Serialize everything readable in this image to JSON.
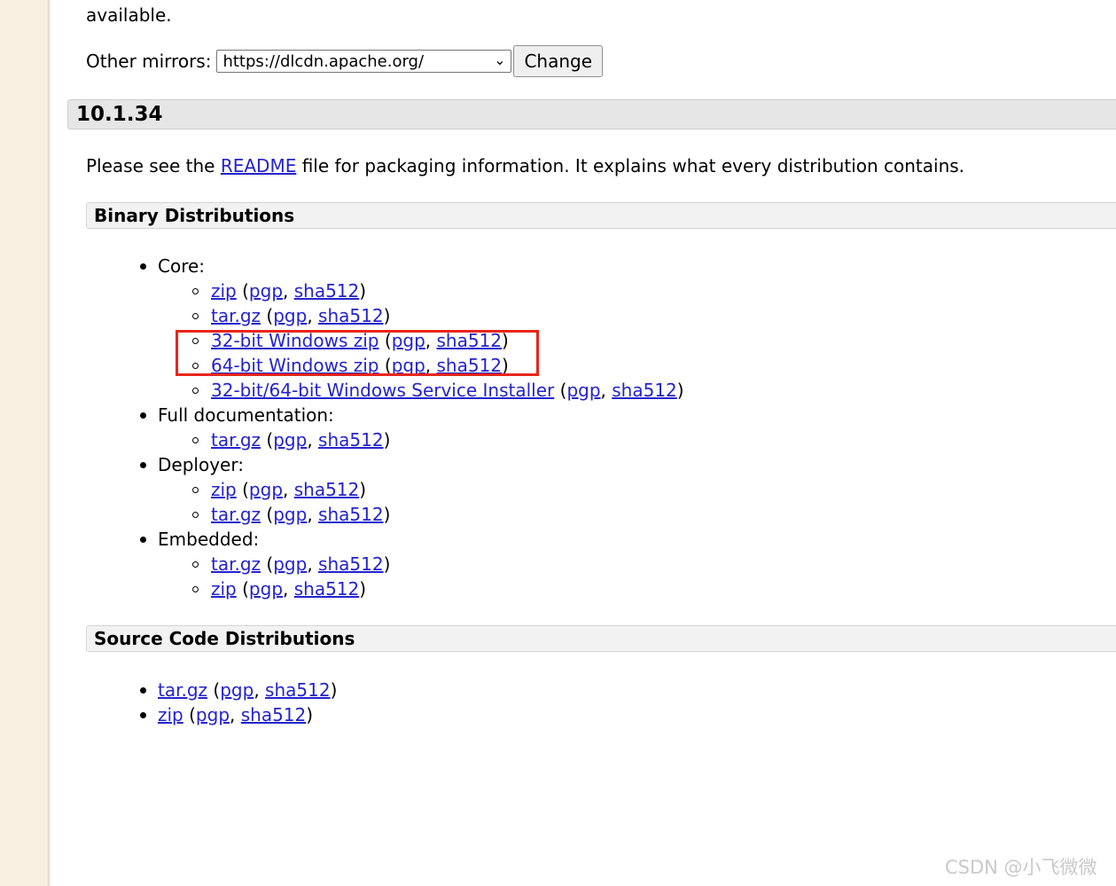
{
  "top_text": "available.",
  "mirrors": {
    "label": "Other mirrors:",
    "selected": "https://dlcdn.apache.org/",
    "button": "Change"
  },
  "version": "10.1.34",
  "readme": {
    "before": "Please see the ",
    "link": "README",
    "after": " file for packaging information. It explains what every distribution contains."
  },
  "binary_title": "Binary Distributions",
  "binary": {
    "core_label": "Core:",
    "core": [
      {
        "name": "zip",
        "pgp": "pgp",
        "sha": "sha512"
      },
      {
        "name": "tar.gz",
        "pgp": "pgp",
        "sha": "sha512"
      },
      {
        "name": "32-bit Windows zip",
        "pgp": "pgp",
        "sha": "sha512"
      },
      {
        "name": "64-bit Windows zip",
        "pgp": "pgp",
        "sha": "sha512"
      },
      {
        "name": "32-bit/64-bit Windows Service Installer",
        "pgp": "pgp",
        "sha": "sha512"
      }
    ],
    "docs_label": "Full documentation:",
    "docs": [
      {
        "name": "tar.gz",
        "pgp": "pgp",
        "sha": "sha512"
      }
    ],
    "deployer_label": "Deployer:",
    "deployer": [
      {
        "name": "zip",
        "pgp": "pgp",
        "sha": "sha512"
      },
      {
        "name": "tar.gz",
        "pgp": "pgp",
        "sha": "sha512"
      }
    ],
    "embedded_label": "Embedded:",
    "embedded": [
      {
        "name": "tar.gz",
        "pgp": "pgp",
        "sha": "sha512"
      },
      {
        "name": "zip",
        "pgp": "pgp",
        "sha": "sha512"
      }
    ]
  },
  "source_title": "Source Code Distributions",
  "source": [
    {
      "name": "tar.gz",
      "pgp": "pgp",
      "sha": "sha512"
    },
    {
      "name": "zip",
      "pgp": "pgp",
      "sha": "sha512"
    }
  ],
  "watermark": "CSDN @小飞微微",
  "colors": {
    "link": "#2323cc",
    "highlight": "#e8261a",
    "sidebar": "#f9efe0"
  }
}
